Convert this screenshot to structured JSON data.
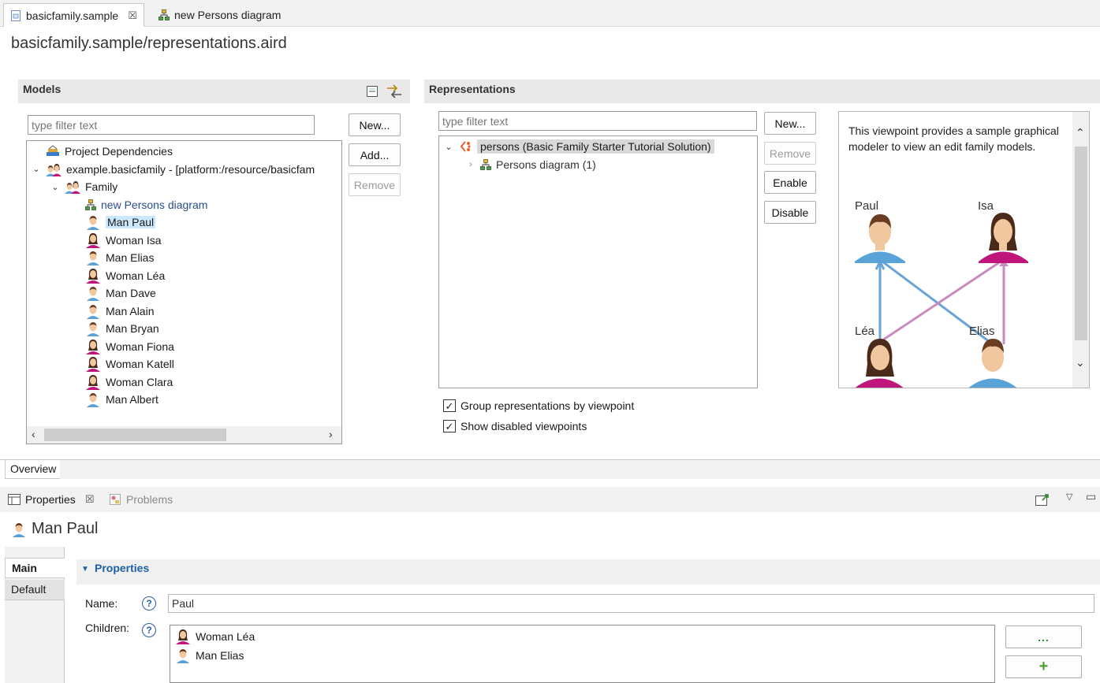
{
  "editor_tabs": [
    {
      "label": "basicfamily.sample",
      "active": true
    },
    {
      "label": "new Persons diagram",
      "active": false
    }
  ],
  "page_title": "basicfamily.sample/representations.aird",
  "models": {
    "header": "Models",
    "filter_placeholder": "type filter text",
    "buttons": {
      "new": "New...",
      "add": "Add...",
      "remove": "Remove"
    },
    "tree": [
      {
        "label": "Project Dependencies",
        "icon": "dependencies-icon",
        "level": 0,
        "chevron": ""
      },
      {
        "label": "example.basicfamily - [platform:/resource/basicfam",
        "icon": "family-icon",
        "level": 0,
        "chevron": "v"
      },
      {
        "label": "Family",
        "icon": "family-icon",
        "level": 1,
        "chevron": "v"
      },
      {
        "label": "new Persons diagram",
        "icon": "diagram-icon",
        "level": 2,
        "chevron": ""
      },
      {
        "label": "Man Paul",
        "icon": "man-icon",
        "level": 2,
        "chevron": "",
        "selected": true
      },
      {
        "label": "Woman Isa",
        "icon": "woman-icon",
        "level": 2,
        "chevron": ""
      },
      {
        "label": "Man Elias",
        "icon": "man-icon",
        "level": 2,
        "chevron": ""
      },
      {
        "label": "Woman Léa",
        "icon": "woman-icon",
        "level": 2,
        "chevron": ""
      },
      {
        "label": "Man Dave",
        "icon": "man-icon",
        "level": 2,
        "chevron": ""
      },
      {
        "label": "Man Alain",
        "icon": "man-icon",
        "level": 2,
        "chevron": ""
      },
      {
        "label": "Man Bryan",
        "icon": "man-icon",
        "level": 2,
        "chevron": ""
      },
      {
        "label": "Woman Fiona",
        "icon": "woman-icon",
        "level": 2,
        "chevron": ""
      },
      {
        "label": "Woman Katell",
        "icon": "woman-icon",
        "level": 2,
        "chevron": ""
      },
      {
        "label": "Woman Clara",
        "icon": "woman-icon",
        "level": 2,
        "chevron": ""
      },
      {
        "label": "Man Albert",
        "icon": "man-icon",
        "level": 2,
        "chevron": ""
      }
    ]
  },
  "representations": {
    "header": "Representations",
    "filter_placeholder": "type filter text",
    "buttons": {
      "new": "New...",
      "remove": "Remove",
      "enable": "Enable",
      "disable": "Disable"
    },
    "viewpoint": "persons (Basic Family Starter Tutorial Solution)",
    "child": "Persons diagram (1)",
    "description": "This viewpoint provides a sample graphical modeler to view an edit family models.",
    "preview_names": {
      "paul": "Paul",
      "isa": "Isa",
      "lea": "Léa",
      "elias": "Elias"
    },
    "checks": [
      {
        "label": "Group representations by viewpoint",
        "checked": true
      },
      {
        "label": "Show disabled viewpoints",
        "checked": true
      }
    ]
  },
  "overview_tab": "Overview",
  "views": {
    "properties": "Properties",
    "problems": "Problems"
  },
  "properties": {
    "title": "Man Paul",
    "side_tabs": [
      "Main",
      "Default"
    ],
    "section": "Properties",
    "name_label": "Name:",
    "name_value": "Paul",
    "children_label": "Children:",
    "children": [
      {
        "label": "Woman Léa",
        "icon": "woman-icon"
      },
      {
        "label": "Man Elias",
        "icon": "man-icon"
      }
    ],
    "btn_more": "...",
    "btn_add": "+"
  },
  "colors": {
    "man": "#5aa3d8",
    "woman": "#c0157a",
    "skin": "#f1c7a0",
    "hair": "#6b3d22"
  }
}
